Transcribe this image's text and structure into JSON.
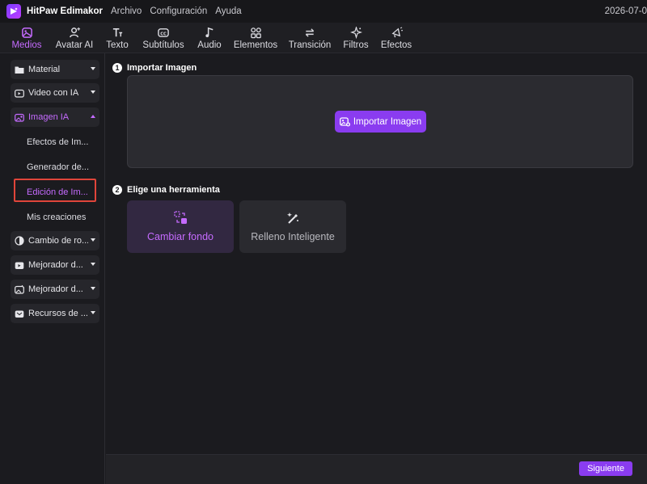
{
  "app": {
    "name": "HitPaw Edimakor",
    "menu": [
      "Archivo",
      "Configuración",
      "Ayuda"
    ],
    "date": "2026-07-0"
  },
  "toolbar": {
    "tabs": [
      {
        "label": "Medios",
        "icon": "media-icon",
        "active": true
      },
      {
        "label": "Avatar AI",
        "icon": "avatar-icon",
        "active": false
      },
      {
        "label": "Texto",
        "icon": "text-icon",
        "active": false
      },
      {
        "label": "Subtítulos",
        "icon": "subtitles-icon",
        "active": false
      },
      {
        "label": "Audio",
        "icon": "audio-icon",
        "active": false
      },
      {
        "label": "Elementos",
        "icon": "elements-icon",
        "active": false
      },
      {
        "label": "Transición",
        "icon": "transition-icon",
        "active": false
      },
      {
        "label": "Filtros",
        "icon": "filters-icon",
        "active": false
      },
      {
        "label": "Efectos",
        "icon": "effects-icon",
        "active": false
      }
    ]
  },
  "sidebar": {
    "items": [
      {
        "label": "Material",
        "icon": "folder-icon"
      },
      {
        "label": "Video con IA",
        "icon": "video-ai-icon"
      },
      {
        "label": "Imagen IA",
        "icon": "image-ai-icon",
        "expanded": true
      },
      {
        "label": "Cambio de ro...",
        "icon": "face-swap-icon"
      },
      {
        "label": "Mejorador d...",
        "icon": "video-enhancer-icon"
      },
      {
        "label": "Mejorador d...",
        "icon": "image-enhancer-icon"
      },
      {
        "label": "Recursos de ...",
        "icon": "resources-icon"
      }
    ],
    "subitems": [
      {
        "label": "Efectos de Im..."
      },
      {
        "label": "Generador de..."
      },
      {
        "label": "Edición de Im...",
        "active": true
      },
      {
        "label": "Mis creaciones"
      }
    ]
  },
  "main": {
    "step1": {
      "number": "1",
      "title": "Importar Imagen"
    },
    "import_button": "Importar Imagen",
    "step2": {
      "number": "2",
      "title": "Elige una herramienta"
    },
    "tools": [
      {
        "label": "Cambiar fondo",
        "icon": "change-background-icon",
        "selected": true
      },
      {
        "label": "Relleno Inteligente",
        "icon": "magic-wand-icon",
        "selected": false
      }
    ]
  },
  "footer": {
    "next_button": "Siguiente"
  },
  "colors": {
    "accent": "#8a3cf0",
    "accent_text": "#c56bff",
    "highlight_box": "#e0453a"
  }
}
